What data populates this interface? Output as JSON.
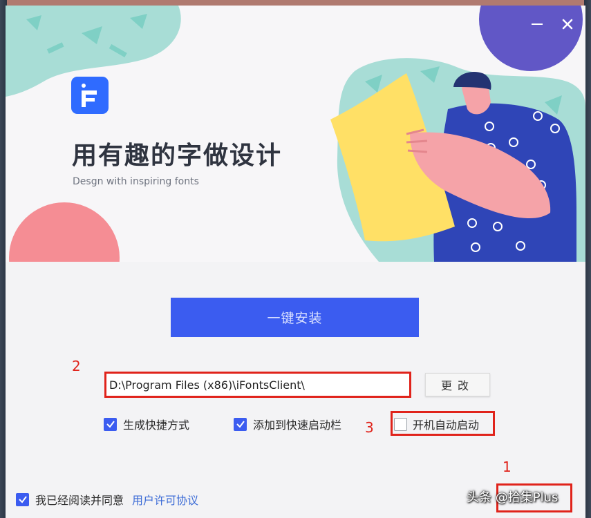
{
  "window": {
    "minimize_label": "—",
    "close_label": "✕"
  },
  "banner": {
    "logo_letter": "F",
    "title": "用有趣的字做设计",
    "subtitle": "Desgn with inspiring fonts"
  },
  "install": {
    "button_label": "一键安装"
  },
  "path": {
    "value": "D:\\Program Files (x86)\\iFontsClient\\",
    "change_label": "更改"
  },
  "options": [
    {
      "label": "生成快捷方式",
      "checked": true
    },
    {
      "label": "添加到快速启动栏",
      "checked": true
    },
    {
      "label": "开机自动启动",
      "checked": false
    }
  ],
  "agreement": {
    "text": "我已经阅读并同意",
    "link": "用户许可协议",
    "checked": true
  },
  "annotations": {
    "one": "1",
    "two": "2",
    "three": "3"
  },
  "watermark": "头条 @拾集Plus",
  "colors": {
    "accent": "#3b5cf0",
    "annotation_red": "#e0231b",
    "logo_blue": "#2f6bff"
  }
}
